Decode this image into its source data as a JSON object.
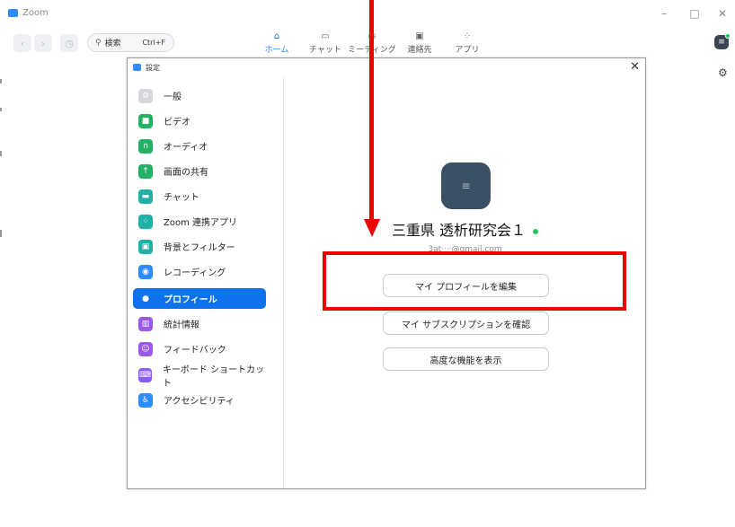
{
  "window": {
    "title": "Zoom",
    "controls": {
      "minimize": "–",
      "maximize": "□",
      "close": "✕"
    }
  },
  "toolbar": {
    "back_icon": "chevron-left-icon",
    "forward_icon": "chevron-right-icon",
    "history_icon": "clock-icon",
    "search": {
      "label": "検索",
      "shortcut": "Ctrl+F"
    },
    "tabs": [
      {
        "label": "ホーム",
        "icon": "home-icon",
        "active": true
      },
      {
        "label": "チャット",
        "icon": "chat-icon",
        "active": false
      },
      {
        "label": "ミーティング",
        "icon": "clock-icon",
        "active": false
      },
      {
        "label": "連絡先",
        "icon": "contacts-icon",
        "active": false
      },
      {
        "label": "アプリ",
        "icon": "apps-icon",
        "active": false
      }
    ]
  },
  "settings_dialog": {
    "title": "設定",
    "close": "✕",
    "nav_items": [
      {
        "label": "一般",
        "icon": "gear-icon",
        "color": "#d5d7da"
      },
      {
        "label": "ビデオ",
        "icon": "video-icon",
        "color": "#23b264"
      },
      {
        "label": "オーディオ",
        "icon": "headphones-icon",
        "color": "#23b264"
      },
      {
        "label": "画面の共有",
        "icon": "share-screen-icon",
        "color": "#23b264"
      },
      {
        "label": "チャット",
        "icon": "chat-icon",
        "color": "#1fb0a6"
      },
      {
        "label": "Zoom 連携アプリ",
        "icon": "apps-icon",
        "color": "#1fb0a6"
      },
      {
        "label": "背景とフィルター",
        "icon": "background-icon",
        "color": "#1fb0a6"
      },
      {
        "label": "レコーディング",
        "icon": "record-icon",
        "color": "#2d8cff"
      },
      {
        "label": "プロフィール",
        "icon": "profile-icon",
        "color": "#0e72ed",
        "active": true
      },
      {
        "label": "統計情報",
        "icon": "stats-icon",
        "color": "#9b59e6"
      },
      {
        "label": "フィードバック",
        "icon": "feedback-icon",
        "color": "#9b59e6"
      },
      {
        "label": "キーボード ショートカット",
        "icon": "keyboard-icon",
        "color": "#8b5cf6"
      },
      {
        "label": "アクセシビリティ",
        "icon": "accessibility-icon",
        "color": "#2d8cff"
      }
    ],
    "profile": {
      "name": "三重県 透析研究会１",
      "email": "3at····@gmail.com",
      "buttons": {
        "edit": "マイ プロフィールを編集",
        "subscription": "マイ サブスクリプションを確認",
        "advanced": "高度な機能を表示"
      }
    }
  },
  "annotation_colors": {
    "arrow": "#ee0000",
    "box": "#ee0000"
  }
}
